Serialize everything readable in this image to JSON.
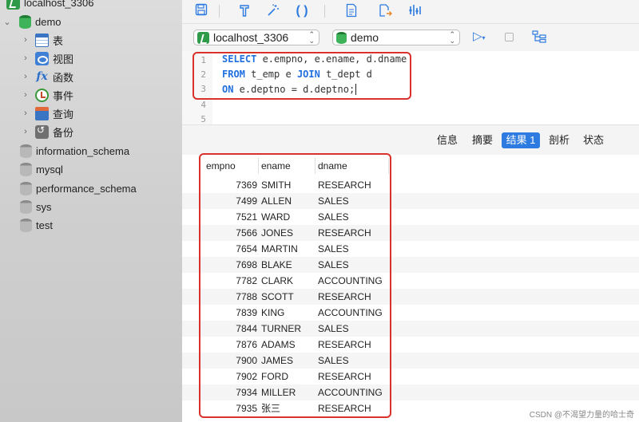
{
  "sidebar": {
    "connection": "localhost_3306",
    "database": "demo",
    "children": [
      {
        "label": "表",
        "icon": "table-icon"
      },
      {
        "label": "视图",
        "icon": "view-icon"
      },
      {
        "label": "函数",
        "icon": "function-icon"
      },
      {
        "label": "事件",
        "icon": "event-icon"
      },
      {
        "label": "查询",
        "icon": "query-icon"
      },
      {
        "label": "备份",
        "icon": "backup-icon"
      }
    ],
    "other_databases": [
      "information_schema",
      "mysql",
      "performance_schema",
      "sys",
      "test"
    ]
  },
  "toolbar": {
    "connection_select": "localhost_3306",
    "database_select": "demo",
    "icons": [
      "save-icon",
      "format-icon",
      "beautify-icon",
      "parentheses-icon",
      "text-icon",
      "export-icon",
      "analyze-icon",
      "run-icon",
      "stop-icon",
      "explain-icon"
    ]
  },
  "editor": {
    "line_numbers": [
      "1",
      "2",
      "3",
      "4",
      "5"
    ],
    "lines": [
      {
        "kw": "SELECT",
        "rest": " e.empno, e.ename, d.dname"
      },
      {
        "kw": "FROM",
        "rest": " t_emp e ",
        "kw2": "JOIN",
        "rest2": " t_dept d"
      },
      {
        "kw": "ON",
        "rest": " e.deptno = d.deptno;"
      }
    ]
  },
  "result_tabs": [
    {
      "label": "信息",
      "active": false
    },
    {
      "label": "摘要",
      "active": false
    },
    {
      "label": "结果 1",
      "active": true
    },
    {
      "label": "剖析",
      "active": false
    },
    {
      "label": "状态",
      "active": false
    }
  ],
  "grid": {
    "columns": [
      "empno",
      "ename",
      "dname"
    ],
    "rows": [
      [
        "7369",
        "SMITH",
        "RESEARCH"
      ],
      [
        "7499",
        "ALLEN",
        "SALES"
      ],
      [
        "7521",
        "WARD",
        "SALES"
      ],
      [
        "7566",
        "JONES",
        "RESEARCH"
      ],
      [
        "7654",
        "MARTIN",
        "SALES"
      ],
      [
        "7698",
        "BLAKE",
        "SALES"
      ],
      [
        "7782",
        "CLARK",
        "ACCOUNTING"
      ],
      [
        "7788",
        "SCOTT",
        "RESEARCH"
      ],
      [
        "7839",
        "KING",
        "ACCOUNTING"
      ],
      [
        "7844",
        "TURNER",
        "SALES"
      ],
      [
        "7876",
        "ADAMS",
        "RESEARCH"
      ],
      [
        "7900",
        "JAMES",
        "SALES"
      ],
      [
        "7902",
        "FORD",
        "RESEARCH"
      ],
      [
        "7934",
        "MILLER",
        "ACCOUNTING"
      ],
      [
        "7935",
        "张三",
        "RESEARCH"
      ]
    ]
  },
  "watermark": "CSDN @不渴望力量的哈士奇",
  "colors": {
    "accent": "#2d7be0",
    "highlight_box": "#d9322b",
    "keyword": "#1f6fe0"
  }
}
